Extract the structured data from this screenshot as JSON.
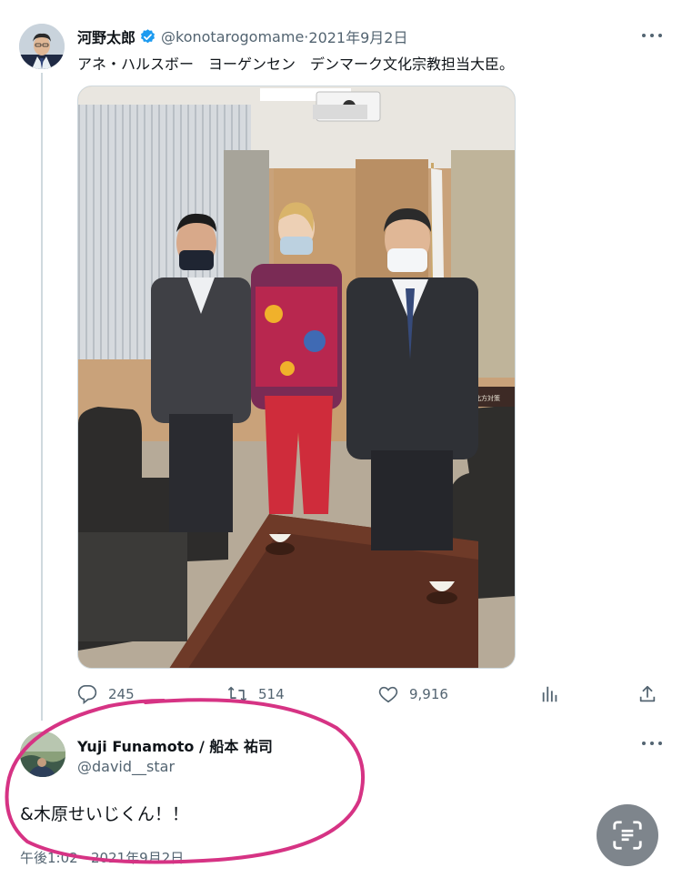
{
  "tweet": {
    "author_name": "河野太郎",
    "handle": "@konotarogomame",
    "separator": " · ",
    "date": "2021年9月2日",
    "text": "アネ・ハルスボー　ヨーゲンセン　デンマーク文化宗教担当大臣。",
    "photo_signs": [
      "北方対策"
    ],
    "metrics": {
      "replies": "245",
      "retweets": "514",
      "likes": "9,916"
    }
  },
  "reply": {
    "author_name": "Yuji Funamoto / 船本 祐司",
    "handle": "@david__star",
    "text": "&木原せいじくん！！",
    "timestamp": "午後1:02 · 2021年9月2日"
  },
  "icons": [
    "verified-badge-icon",
    "more-icon",
    "reply-icon",
    "retweet-icon",
    "like-icon",
    "views-icon",
    "share-icon",
    "scan-icon"
  ],
  "colors": {
    "text_primary": "#0f1419",
    "text_secondary": "#536471",
    "verified_blue": "#1d9bf0",
    "highlight_pink": "#d63384",
    "thread_line": "#cfd9de"
  }
}
